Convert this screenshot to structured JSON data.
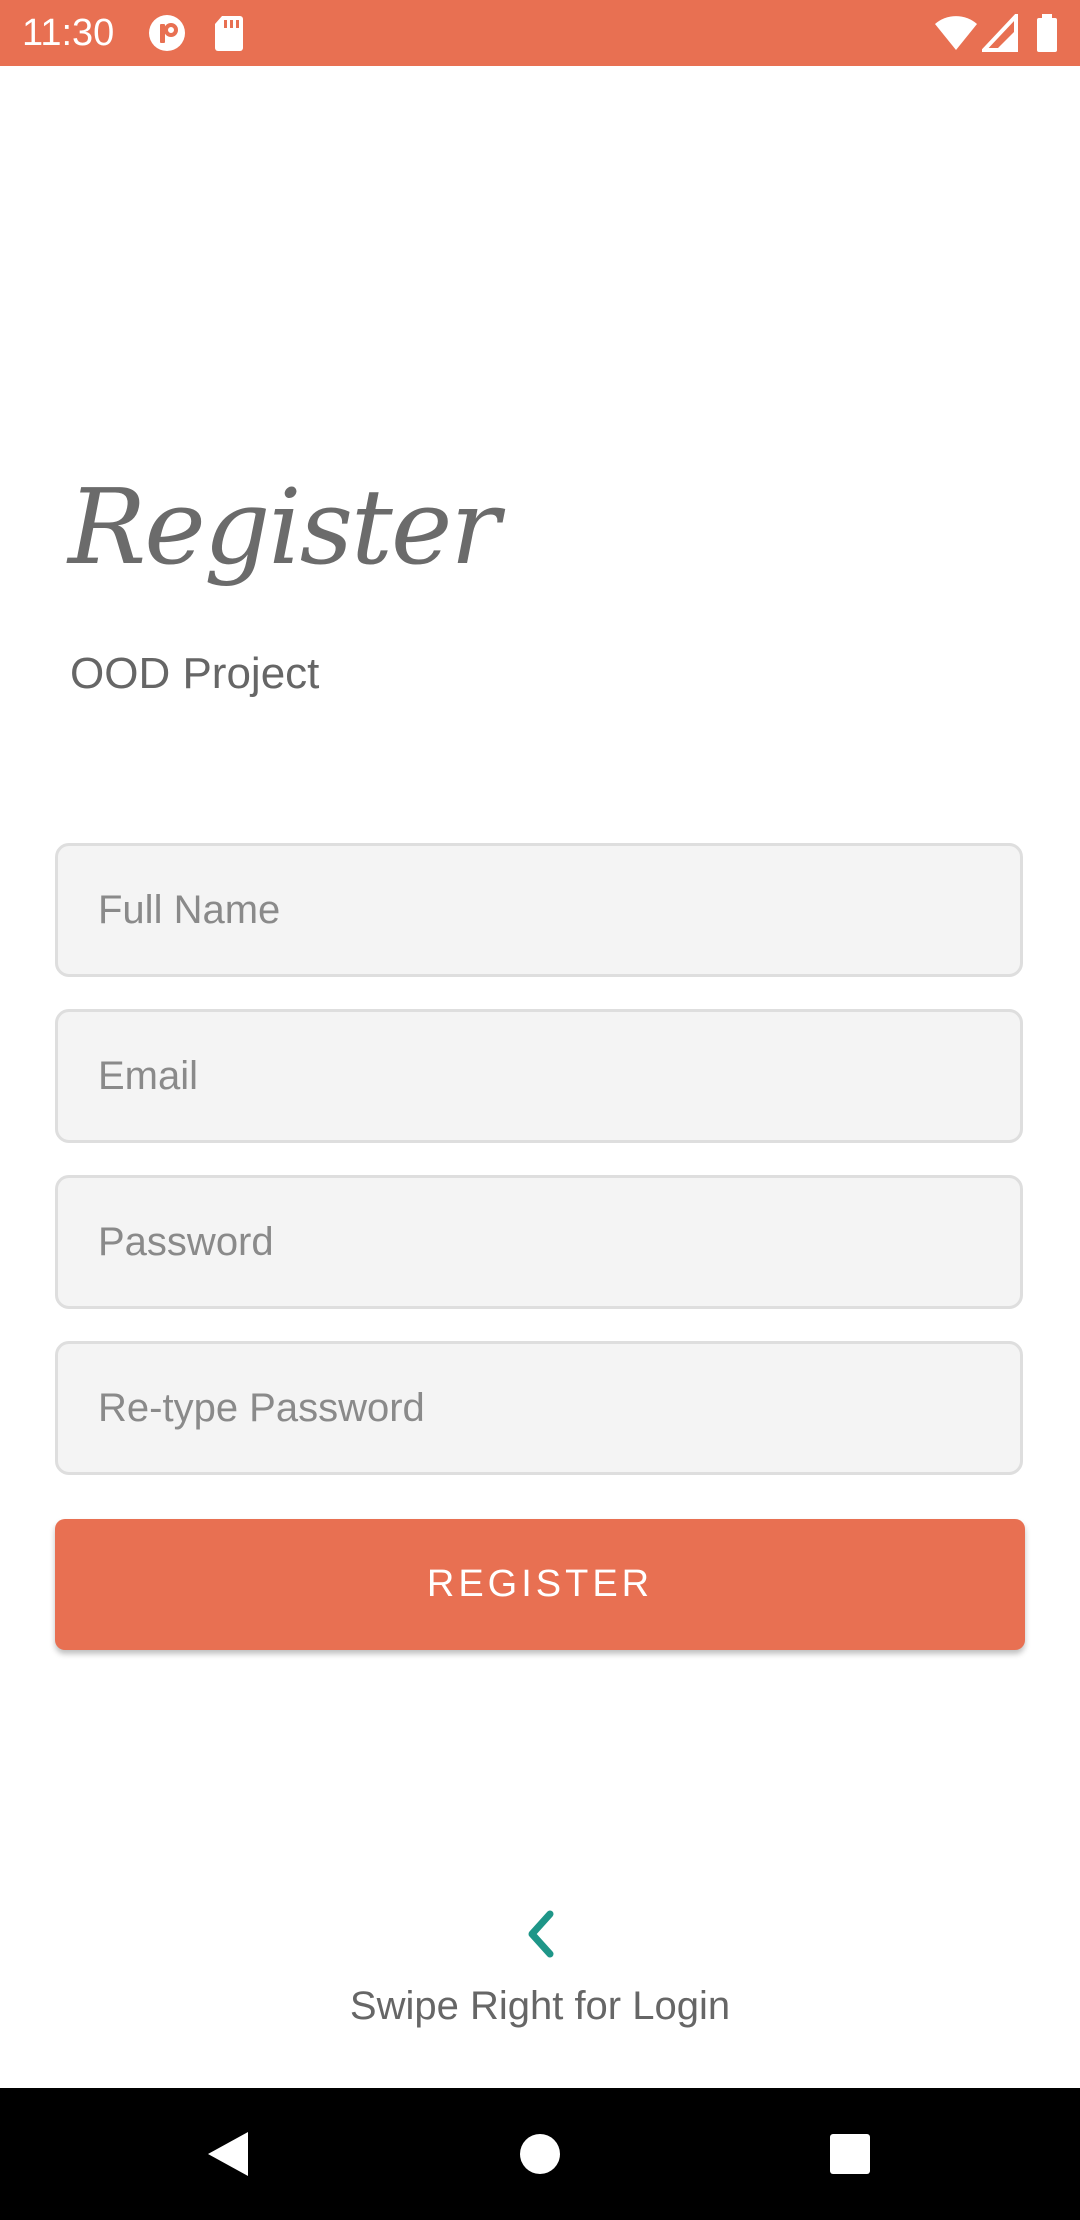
{
  "status_bar": {
    "time": "11:30",
    "color": "#E87052",
    "icons": [
      "app-notification-icon",
      "sd-card-icon",
      "wifi-icon",
      "signal-icon",
      "battery-icon"
    ]
  },
  "header": {
    "title": "Register",
    "subtitle": "OOD Project"
  },
  "form": {
    "full_name": {
      "placeholder": "Full Name",
      "value": ""
    },
    "email": {
      "placeholder": "Email",
      "value": ""
    },
    "password": {
      "placeholder": "Password",
      "value": ""
    },
    "retype_password": {
      "placeholder": "Re-type Password",
      "value": ""
    },
    "register_label": "REGISTER"
  },
  "swipe_hint": {
    "icon": "chevron-left-icon",
    "text": "Swipe Right for Login",
    "accent_color": "#1E9688"
  },
  "nav_bar": {
    "icons": [
      "back-icon",
      "home-icon",
      "recents-icon"
    ]
  }
}
